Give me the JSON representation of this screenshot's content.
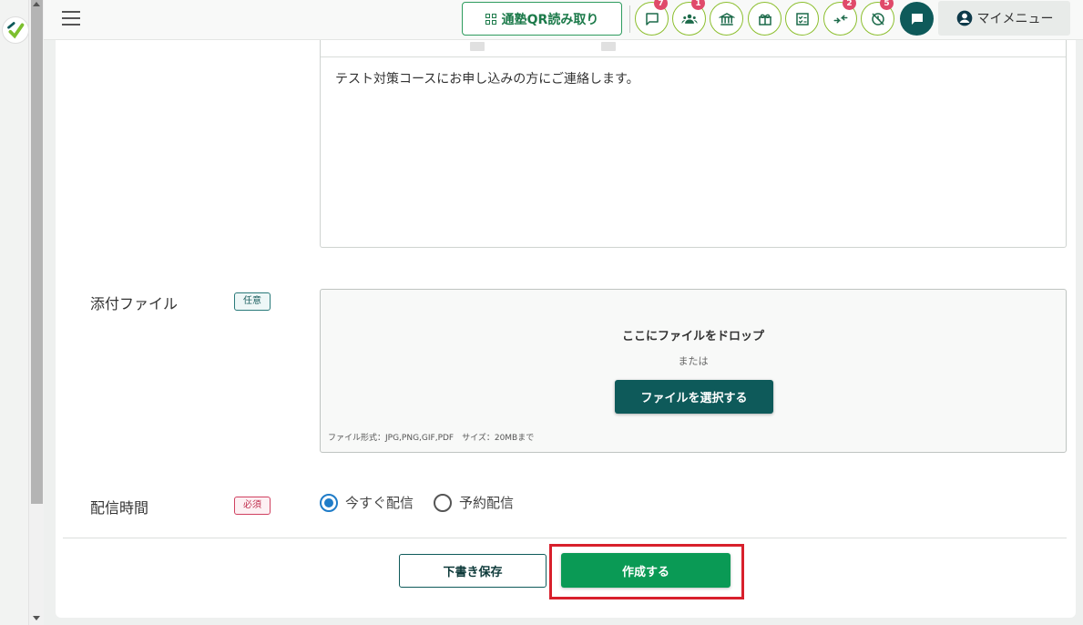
{
  "header": {
    "menu_icon": "hamburger-icon",
    "qr_button_label": "通塾QR読み取り",
    "icons": [
      {
        "name": "chat-icon",
        "badge": "7"
      },
      {
        "name": "group-icon",
        "badge": "1"
      },
      {
        "name": "school-icon",
        "badge": ""
      },
      {
        "name": "gift-icon",
        "badge": ""
      },
      {
        "name": "checklist-icon",
        "badge": ""
      },
      {
        "name": "merge-arrows-icon",
        "badge": "2"
      },
      {
        "name": "clock-off-icon",
        "badge": "5"
      }
    ],
    "chat_button_icon": "message-icon",
    "my_menu_label": "マイメニュー"
  },
  "form": {
    "message_text": "テスト対策コースにお申し込みの方にご連絡します。",
    "attachment": {
      "label": "添付ファイル",
      "tag": "任意",
      "drop_title": "ここにファイルをドロップ",
      "drop_or": "または",
      "choose_button": "ファイルを選択する",
      "note": "ファイル形式：JPG,PNG,GIF,PDF　サイズ：20MBまで"
    },
    "delivery": {
      "label": "配信時間",
      "tag": "必須",
      "options": [
        {
          "label": "今すぐ配信",
          "selected": true
        },
        {
          "label": "予約配信",
          "selected": false
        }
      ]
    }
  },
  "actions": {
    "draft_label": "下書き保存",
    "create_label": "作成する"
  },
  "colors": {
    "brand_dark": "#0e5a5a",
    "primary_green": "#0a9a55",
    "badge": "#e04a6a",
    "highlight": "#d8202c"
  }
}
